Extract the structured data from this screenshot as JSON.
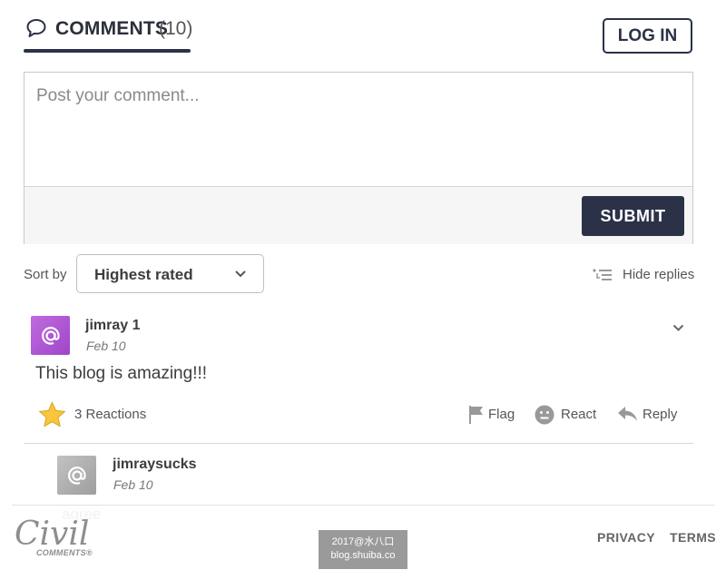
{
  "header": {
    "tab_title": "COMMENTS",
    "tab_count": "(10)",
    "login_label": "LOG IN"
  },
  "composer": {
    "placeholder": "Post your comment...",
    "submit_label": "SUBMIT"
  },
  "sort": {
    "label": "Sort by",
    "selected": "Highest rated",
    "hide_replies_label": "Hide replies"
  },
  "comments": [
    {
      "user": "jimray 1",
      "date": "Feb 10",
      "body": "This blog is amazing!!!",
      "reactions_label": "3 Reactions",
      "actions": {
        "flag": "Flag",
        "react": "React",
        "reply": "Reply"
      },
      "replies": [
        {
          "user": "jimraysucks",
          "date": "Feb 10",
          "body": "agree"
        }
      ]
    }
  ],
  "footer": {
    "brand": "Civil",
    "brand_sub": "COMMENTS®",
    "privacy": "PRIVACY",
    "terms": "TERMS"
  },
  "watermark": {
    "line1": "2017@水八口",
    "line2": "blog.shuiba.co"
  },
  "colors": {
    "navy": "#2b3248",
    "avatar_purple": "#b15cd6",
    "avatar_gray": "#aeaeae",
    "star": "#f7c63c"
  },
  "icons": [
    "speech-bubble-icon",
    "chevron-down-icon",
    "hide-replies-icon",
    "star-icon",
    "flag-icon",
    "smiley-icon",
    "reply-arrow-icon",
    "at-sign-icon"
  ]
}
